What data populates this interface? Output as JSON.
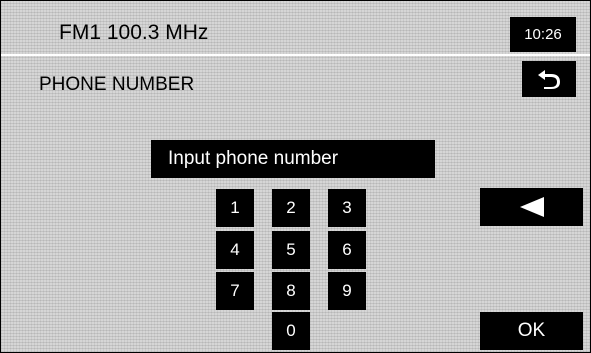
{
  "header": {
    "station": "FM1  100.3 MHz",
    "clock": "10:26"
  },
  "page": {
    "title": "PHONE NUMBER"
  },
  "entry": {
    "prompt": "Input phone number"
  },
  "keypad": {
    "k1": "1",
    "k2": "2",
    "k3": "3",
    "k4": "4",
    "k5": "5",
    "k6": "6",
    "k7": "7",
    "k8": "8",
    "k9": "9",
    "k0": "0"
  },
  "buttons": {
    "ok": "OK"
  },
  "icons": {
    "back": "back-arrow-icon",
    "backspace": "left-triangle-icon"
  },
  "colors": {
    "background": "#d6d6d6",
    "button": "#000000",
    "button_text": "#ffffff"
  }
}
